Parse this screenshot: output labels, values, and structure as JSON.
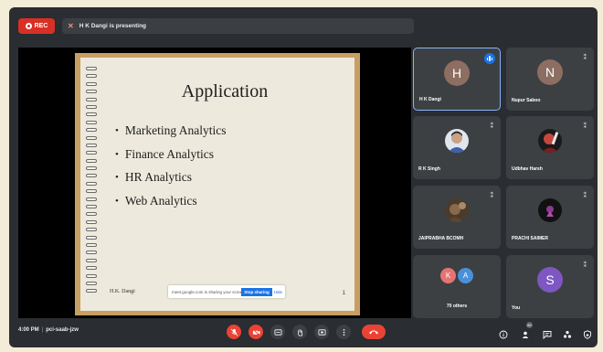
{
  "topbar": {
    "rec_label": "REC",
    "presenting_text": "H K Dangi is presenting"
  },
  "slide": {
    "title": "Application",
    "bullets": [
      "Marketing Analytics",
      "Finance Analytics",
      "HR Analytics",
      "Web Analytics"
    ],
    "author": "H.K. Dangi",
    "page_number": "1",
    "share_bar": {
      "message": "meet.google.com is sharing your screen",
      "stop_label": "Stop sharing",
      "hide_label": "Hide"
    }
  },
  "participants": [
    {
      "name": "H K Dangi",
      "initial": "H",
      "color": "#8d6e63",
      "speaking": true
    },
    {
      "name": "Nupur Saboo",
      "initial": "N",
      "color": "#8d6e63",
      "muted": true
    },
    {
      "name": "R K Singh",
      "photo": true,
      "muted": true
    },
    {
      "name": "Udbhav Harsh",
      "photo": true,
      "muted": true
    },
    {
      "name": "JAIPRABHA BCOMH",
      "photo": true,
      "muted": true
    },
    {
      "name": "PRACHI SAIMER",
      "photo": true,
      "muted": true
    },
    {
      "others_label": "70 others",
      "initials": [
        "K",
        "A"
      ],
      "colors": [
        "#e57373",
        "#4a90d9"
      ]
    },
    {
      "name": "You",
      "initial": "S",
      "color": "#7e57c2",
      "muted": true
    }
  ],
  "bottombar": {
    "time": "4:00 PM",
    "meeting_code": "pci-saab-jzw",
    "participant_count": "80"
  },
  "colors": {
    "accent": "#1a73e8",
    "danger": "#ea4335",
    "tile_bg": "#3c4043"
  }
}
